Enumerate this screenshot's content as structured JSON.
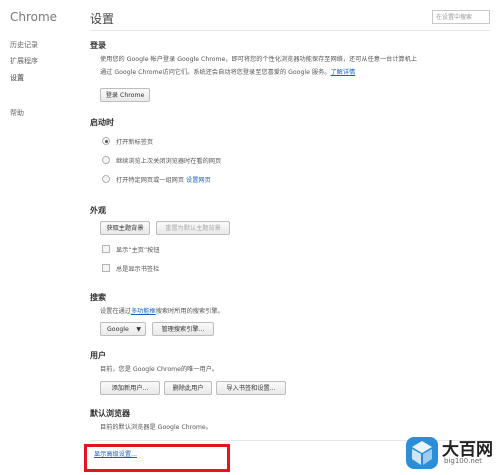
{
  "sidebar": {
    "brand": "Chrome",
    "items": [
      {
        "label": "历史记录"
      },
      {
        "label": "扩展程序"
      },
      {
        "label": "设置"
      },
      {
        "label": "帮助"
      }
    ]
  },
  "header": {
    "title": "设置",
    "search_placeholder": "在设置中搜索"
  },
  "signin": {
    "title": "登录",
    "line1": "使用您的 Google 帐户登录 Google Chrome，即可将您的个性化浏览器功能保存至网络，还可从任意一台计算机上",
    "line2": "通过 Google Chrome访问它们。系统还会自动将您登录至您喜爱的 Google 服务。",
    "learn_more": "了解详情",
    "button": "登录 Chrome"
  },
  "startup": {
    "title": "启动时",
    "options": [
      {
        "label": "打开新标签页",
        "checked": true
      },
      {
        "label": "继续浏览上次关闭浏览器时在看的网页",
        "checked": false
      },
      {
        "label": "打开特定网页或一组网页",
        "checked": false
      }
    ],
    "set_pages_link": "设置网页"
  },
  "appearance": {
    "title": "外观",
    "get_themes": "获取主题背景",
    "reset_theme": "重置为默认主题背景",
    "show_home": "显示“主页”按钮",
    "show_bookmarks": "总是显示书签栏"
  },
  "search_section": {
    "title": "搜索",
    "text_prefix": "设置在通过",
    "omnibox_link": "多功能框",
    "text_suffix": "搜索时所用的搜索引擎。",
    "engine": "Google",
    "manage": "管理搜索引擎..."
  },
  "users": {
    "title": "用户",
    "text": "目前，您是 Google Chrome的唯一用户。",
    "add": "添加新用户...",
    "delete": "删除此用户",
    "import": "导入书签和设置..."
  },
  "default_browser": {
    "title": "默认浏览器",
    "text": "目前的默认浏览器是 Google Chrome。"
  },
  "advanced": {
    "link": "显示高级设置..."
  },
  "watermark": {
    "name": "大百网",
    "url": "big100.net"
  }
}
